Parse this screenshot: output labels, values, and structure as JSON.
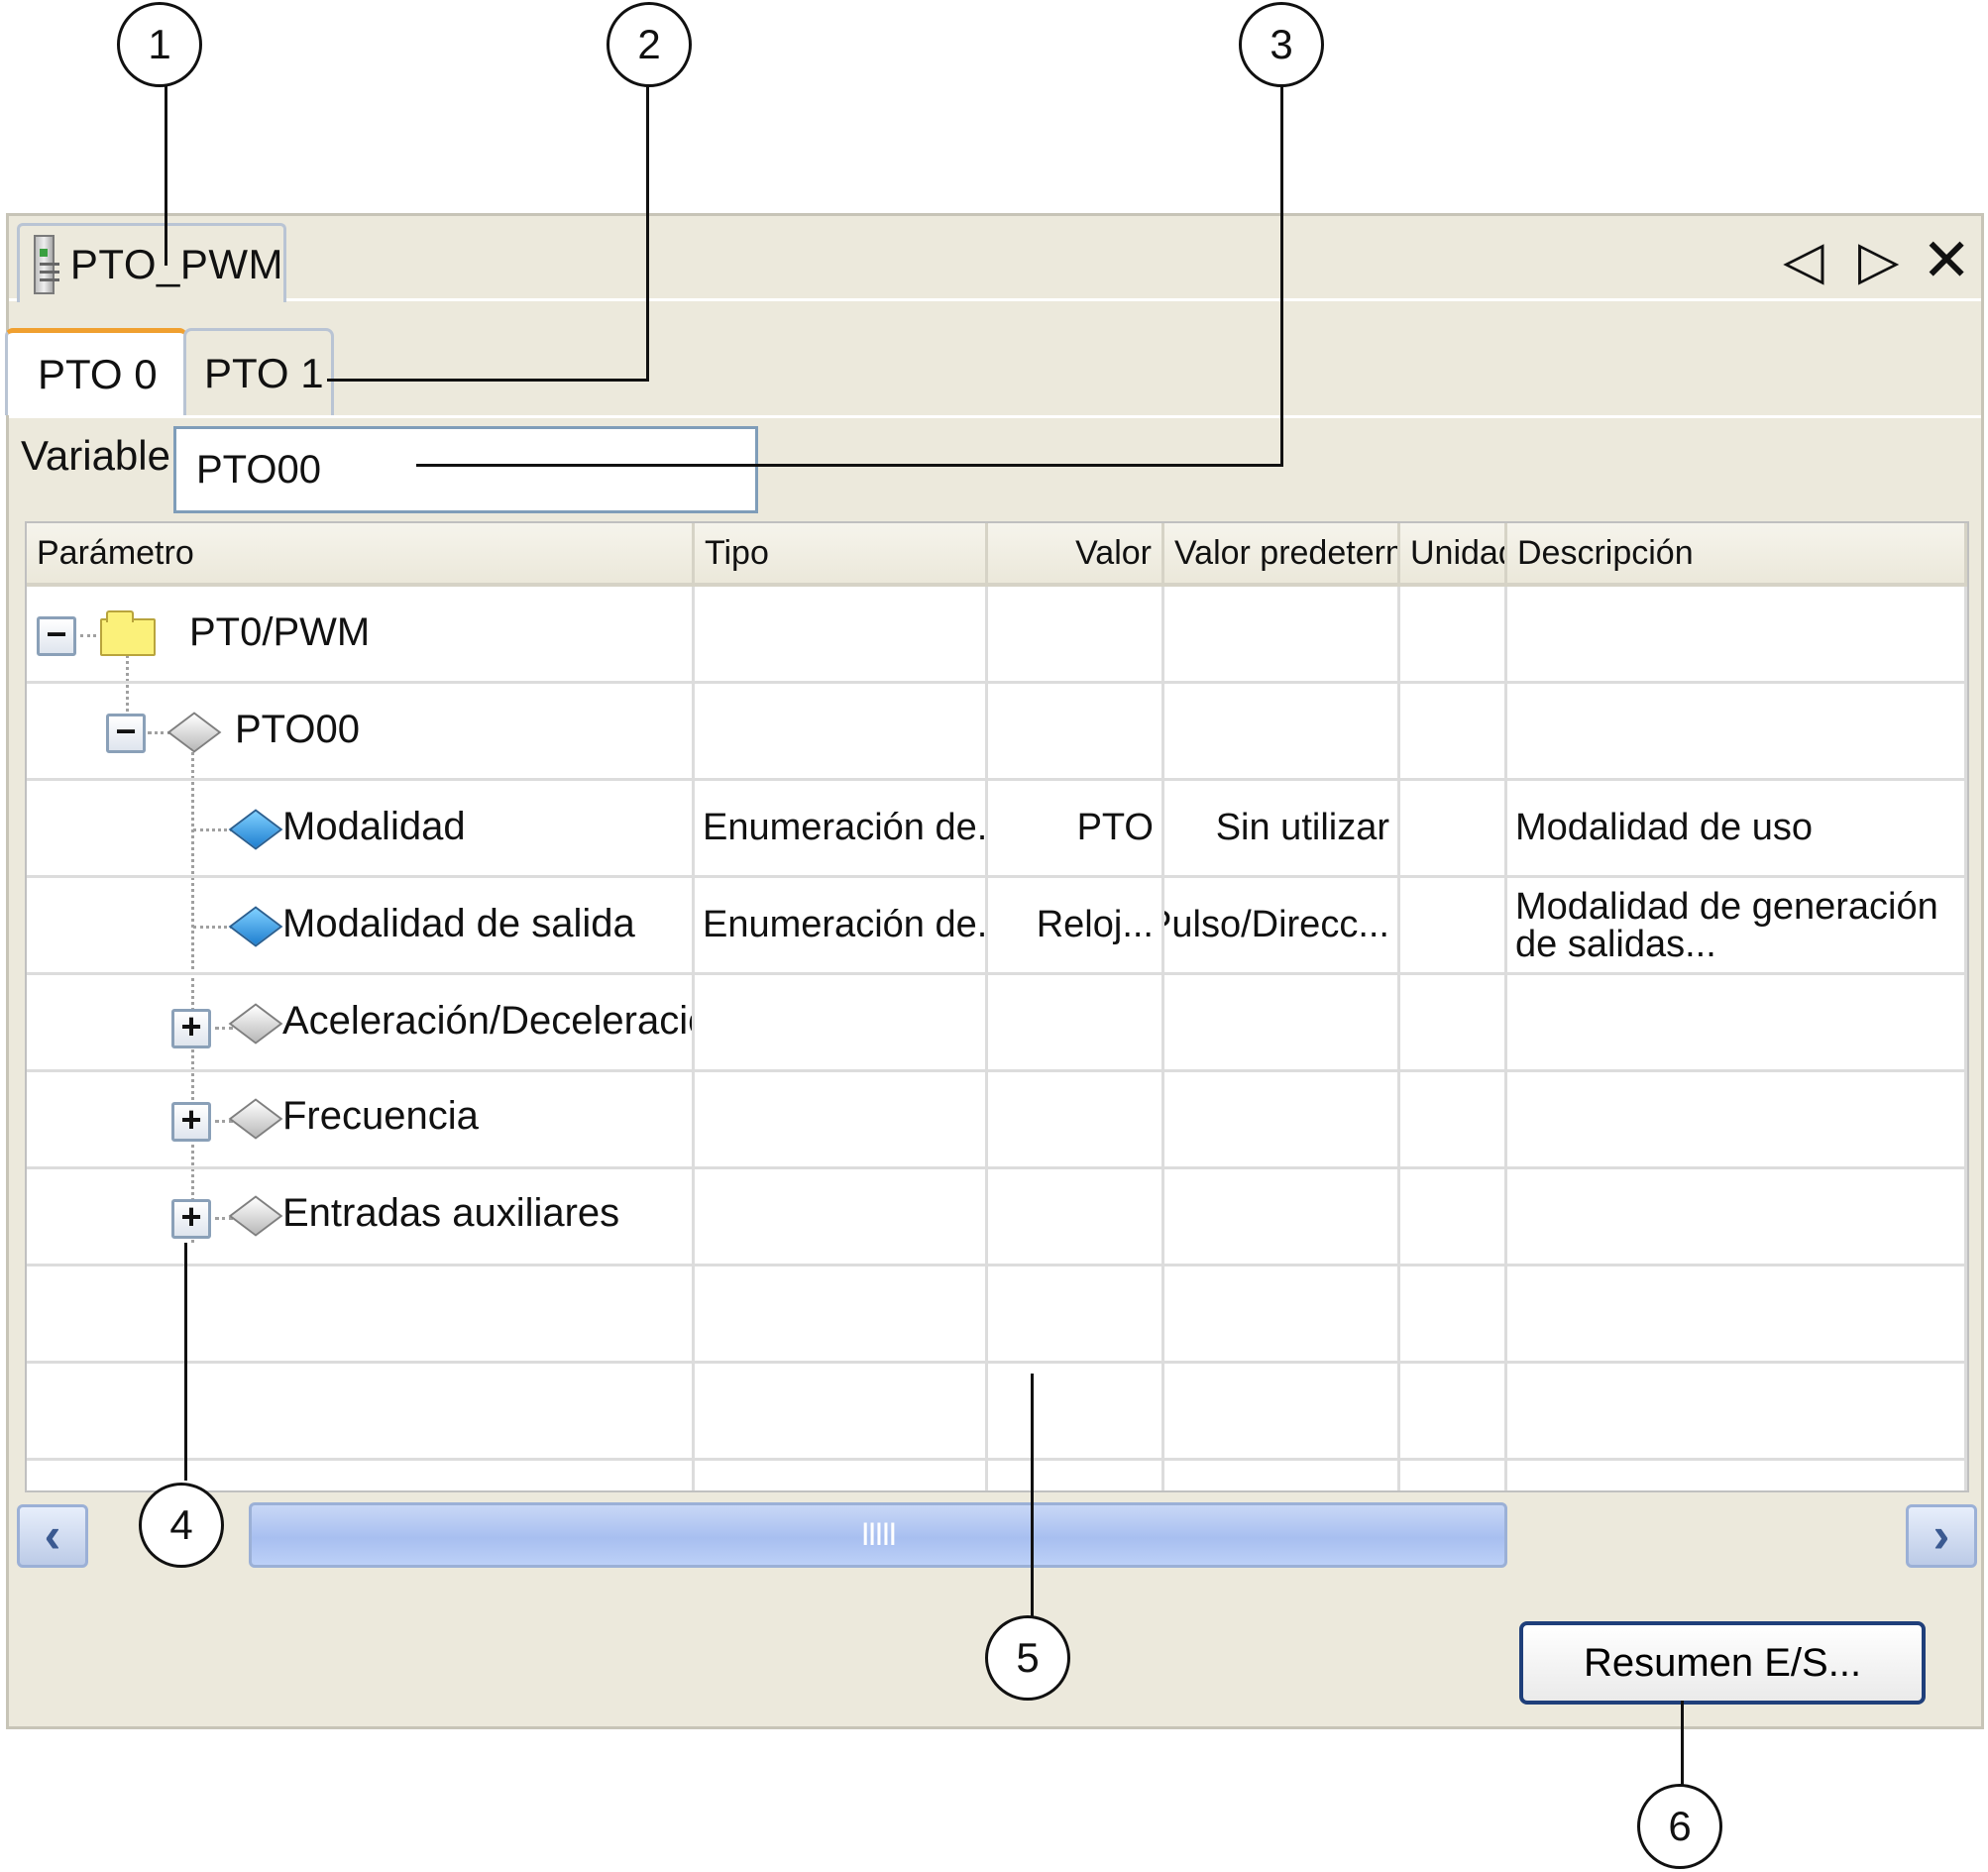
{
  "document_tab": {
    "title": "PTO_PWM"
  },
  "nav": {
    "prev": "◁",
    "next": "▷",
    "close": "✕"
  },
  "tabs": [
    {
      "label": "PTO 0"
    },
    {
      "label": "PTO 1"
    }
  ],
  "variable": {
    "label": "Variable:",
    "value": "PTO00"
  },
  "table": {
    "columns": [
      "Parámetro",
      "Tipo",
      "Valor",
      "Valor predeterm.",
      "Unidad",
      "Descripción"
    ],
    "rows": [
      {
        "name": "PT0/PWM",
        "type": "",
        "value": "",
        "default": "",
        "unit": "",
        "desc": ""
      },
      {
        "name": "PTO00",
        "type": "",
        "value": "",
        "default": "",
        "unit": "",
        "desc": ""
      },
      {
        "name": "Modalidad",
        "type": "Enumeración de...",
        "value": "PTO",
        "default": "Sin utilizar",
        "unit": "",
        "desc": "Modalidad de uso"
      },
      {
        "name": "Modalidad de salida",
        "type": "Enumeración de...",
        "value": "Reloj...",
        "default": "Pulso/Direcc...",
        "unit": "",
        "desc": "Modalidad de generación de salidas..."
      },
      {
        "name": "Aceleración/Deceleración",
        "type": "",
        "value": "",
        "default": "",
        "unit": "",
        "desc": ""
      },
      {
        "name": "Frecuencia",
        "type": "",
        "value": "",
        "default": "",
        "unit": "",
        "desc": ""
      },
      {
        "name": "Entradas auxiliares",
        "type": "",
        "value": "",
        "default": "",
        "unit": "",
        "desc": ""
      }
    ],
    "toggles": {
      "collapse": "−",
      "expand": "+"
    }
  },
  "scrollbar": {
    "left": "‹",
    "right": "›",
    "thumb_grip": "IIIII"
  },
  "summary_button": {
    "label": "Resumen E/S..."
  },
  "callouts": [
    "1",
    "2",
    "3",
    "4",
    "5",
    "6"
  ]
}
